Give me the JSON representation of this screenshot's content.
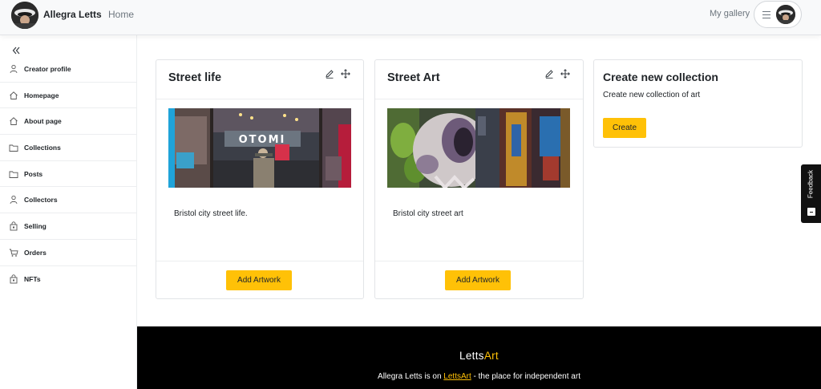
{
  "header": {
    "brand_name": "Allegra Letts",
    "home_label": "Home",
    "my_gallery_label": "My gallery"
  },
  "sidebar": {
    "items": [
      {
        "label": "Creator profile",
        "icon": "user-icon"
      },
      {
        "label": "Homepage",
        "icon": "home-icon"
      },
      {
        "label": "About page",
        "icon": "home-icon"
      },
      {
        "label": "Collections",
        "icon": "folder-icon"
      },
      {
        "label": "Posts",
        "icon": "folder-icon"
      },
      {
        "label": "Collectors",
        "icon": "user-icon"
      },
      {
        "label": "Selling",
        "icon": "bag-icon"
      },
      {
        "label": "Orders",
        "icon": "cart-icon"
      },
      {
        "label": "NFTs",
        "icon": "bag-icon"
      }
    ]
  },
  "collections": [
    {
      "title": "Street life",
      "description": "Bristol city street life.",
      "button_label": "Add Artwork"
    },
    {
      "title": "Street Art",
      "description": "Bristol city street art",
      "button_label": "Add Artwork"
    }
  ],
  "new_collection": {
    "title": "Create new collection",
    "description": "Create new collection of art",
    "button_label": "Create"
  },
  "footer": {
    "logo_part1": "Letts",
    "logo_part2": "Art",
    "text_prefix": "Allegra Letts is on ",
    "link_text": "LettsArt",
    "text_suffix": " - the place for independent art"
  },
  "feedback": {
    "label": "Feedback"
  },
  "colors": {
    "accent": "#ffc107",
    "footer_bg": "#000000",
    "topbar_bg": "#f8f9fa"
  }
}
